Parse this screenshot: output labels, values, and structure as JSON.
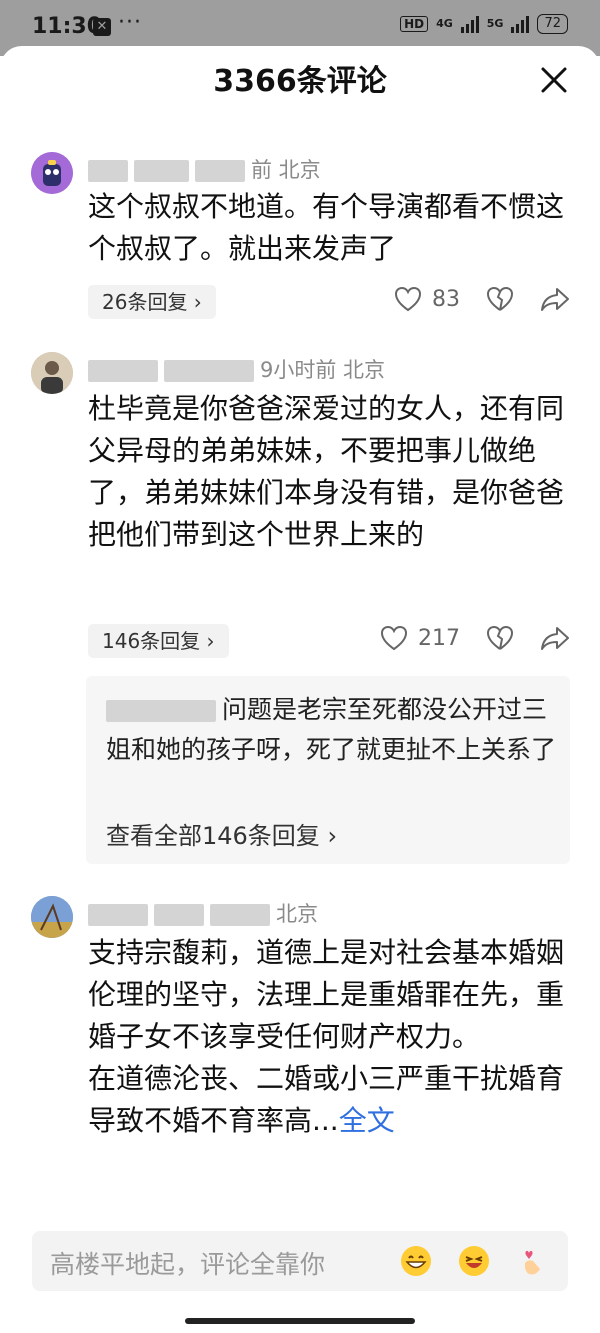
{
  "status_bar": {
    "time": "11:30",
    "app_icon": "capcut-icon",
    "dots": "···",
    "hd": "HD",
    "net1": "4G",
    "net2": "5G",
    "battery": "72"
  },
  "header": {
    "title": "3366条评论"
  },
  "comments": [
    {
      "meta": "前 北京",
      "text": "这个叔叔不地道。有个导演都看不惯这个叔叔了。就出来发声了",
      "replies_label": "26条回复",
      "likes": "83"
    },
    {
      "meta": "9小时前 北京",
      "text": "杜毕竟是你爸爸深爱过的女人，还有同父异母的弟弟妹妹，不要把事儿做绝了，弟弟妹妹们本身没有错，是你爸爸把他们带到这个世界上来的",
      "replies_label": "146条回复",
      "likes": "217",
      "reply_preview": "问题是老宗至死都没公开过三姐和她的孩子呀，死了就更扯不上关系了",
      "view_all": "查看全部146条回复"
    },
    {
      "meta": "北京",
      "text": "支持宗馥莉，道德上是对社会基本婚姻伦理的坚守，法理上是重婚罪在先，重婚子女不该享受任何财产权力。\n在道德沦丧、二婚或小三严重干扰婚育导致不婚不育率高...",
      "fulltext_label": "全文"
    }
  ],
  "input": {
    "placeholder": "高楼平地起，评论全靠你"
  },
  "colors": {
    "link": "#2f6fe0",
    "meta": "#8a8a8a",
    "status_bar": "#9e9e9e"
  }
}
